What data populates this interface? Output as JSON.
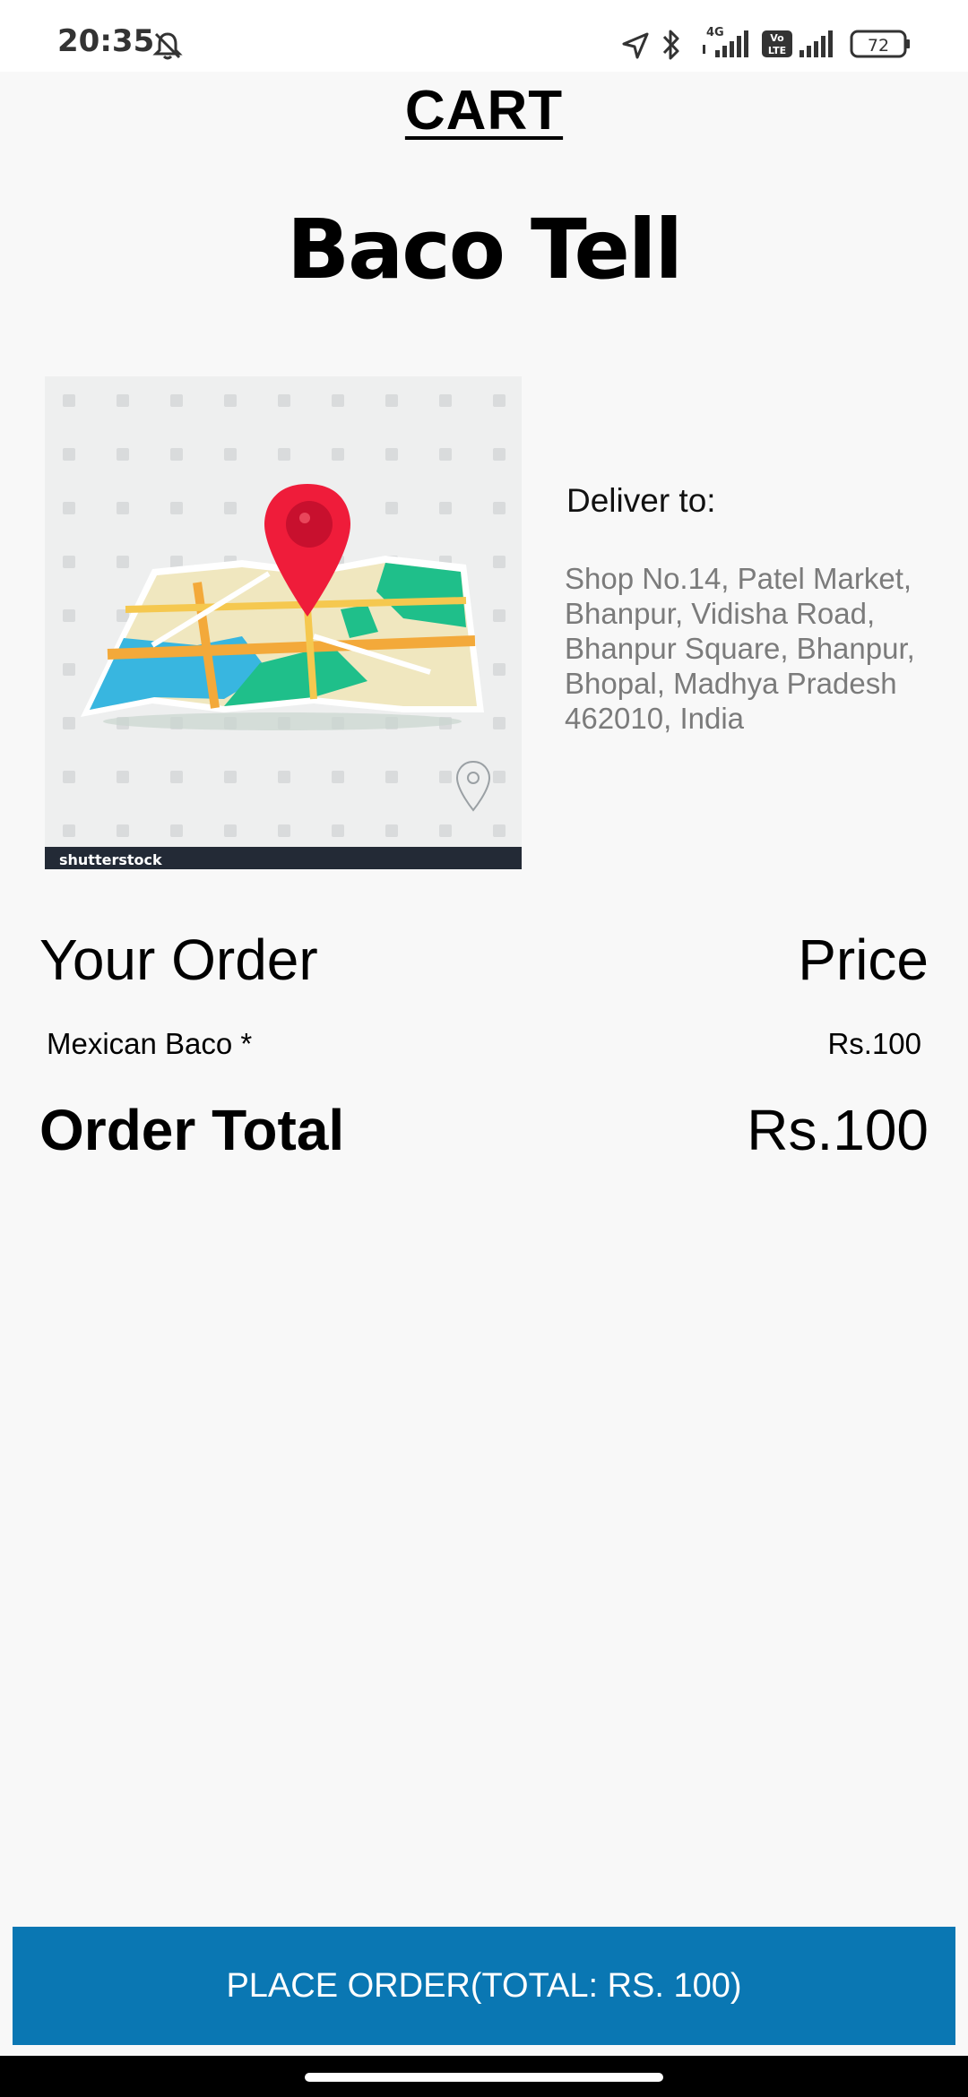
{
  "status_bar": {
    "time": "20:35",
    "battery": "72",
    "network_label": "4G",
    "volte_label": "Vo LTE",
    "icons": [
      "bell-off-icon",
      "location-arrow-icon",
      "bluetooth-icon",
      "signal-icon",
      "volte-icon",
      "signal-icon",
      "battery-icon"
    ]
  },
  "header": {
    "title": "CART",
    "store_name": "Baco Tell"
  },
  "map_image": {
    "watermark": "shutterstock",
    "icon": "map-pin-icon"
  },
  "delivery": {
    "label": "Deliver to:",
    "address": "Shop No.14, Patel Market, Bhanpur, Vidisha Road, Bhanpur Square, Bhanpur, Bhopal, Madhya Pradesh 462010, India"
  },
  "order": {
    "heading": "Your Order",
    "price_heading": "Price",
    "items": [
      {
        "name": "Mexican Baco *",
        "price": "Rs.100"
      }
    ],
    "total_label": "Order Total",
    "total_value": "Rs.100"
  },
  "actions": {
    "place_order_label": "PLACE ORDER(TOTAL: RS. 100)"
  },
  "colors": {
    "button": "#0a77b3",
    "background": "#f8f8f8",
    "address_text": "#7b7b7b"
  }
}
